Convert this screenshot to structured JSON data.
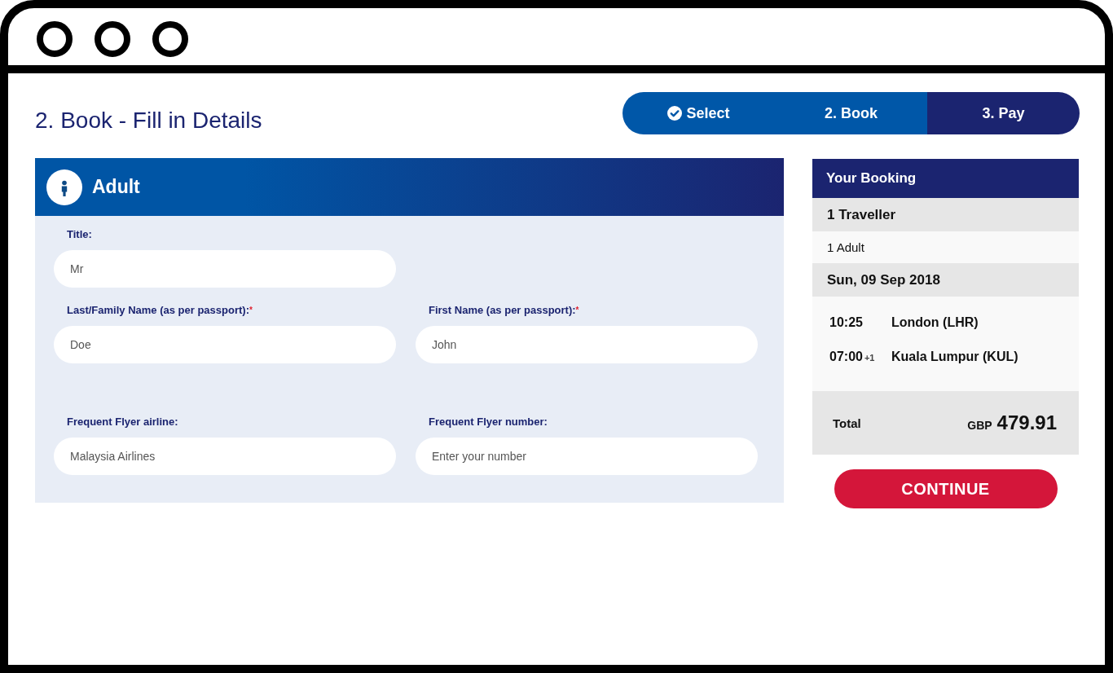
{
  "page_title": "2. Book - Fill in Details",
  "steps": [
    {
      "label": "Select",
      "completed": true,
      "reached": true
    },
    {
      "label": "2. Book",
      "completed": false,
      "reached": true
    },
    {
      "label": "3. Pay",
      "completed": false,
      "reached": false
    }
  ],
  "passenger_form": {
    "title": "Adult",
    "rows": [
      [
        {
          "label": "Title:",
          "value": "Mr"
        }
      ],
      [
        {
          "label": "Last/Family Name (as per passport):",
          "required_mark": "*",
          "value": "Doe"
        },
        {
          "label": "First Name (as per passport):",
          "required_mark": "*",
          "value": "John"
        }
      ],
      [
        {
          "label": "Frequent Flyer airline:",
          "value": "Malaysia Airlines"
        },
        {
          "label": "Frequent Flyer number:",
          "placeholder": "Enter your number"
        }
      ]
    ]
  },
  "booking_summary": {
    "title": "Your Booking",
    "travellers": "1 Traveller",
    "passengers": "1 Adult",
    "date": "Sun, 09 Sep 2018",
    "flights": [
      {
        "time": "10:25",
        "place": "London (LHR)"
      },
      {
        "time": "07:00",
        "day_offset": "+1",
        "place": "Kuala Lumpur (KUL)"
      }
    ],
    "total_label": "Total",
    "currency": "GBP",
    "total": "479.91"
  },
  "continue_button": "CONTINUE"
}
